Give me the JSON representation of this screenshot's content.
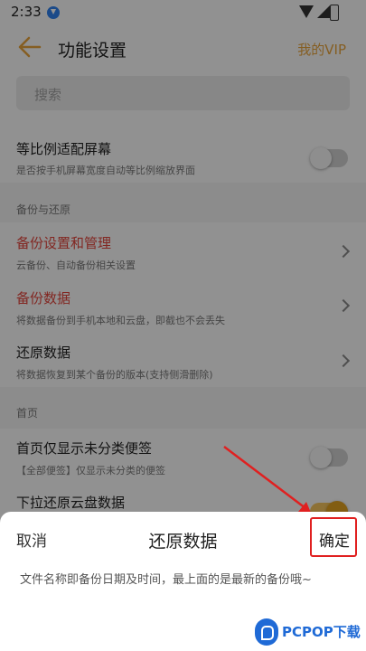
{
  "status_bar": {
    "time": "2:33"
  },
  "header": {
    "title": "功能设置",
    "vip_label": "我的VIP"
  },
  "search": {
    "placeholder": "搜索"
  },
  "settings": {
    "partial_top": "",
    "row_scale": {
      "title": "等比例适配屏幕",
      "subtitle": "是否按手机屏幕宽度自动等比例缩放界面",
      "toggle": "off"
    },
    "section_backup": "备份与还原",
    "row_backup_manage": {
      "title": "备份设置和管理",
      "subtitle": "云备份、自动备份相关设置"
    },
    "row_backup_data": {
      "title": "备份数据",
      "subtitle": "将数据备份到手机本地和云盘，即截也不会丢失"
    },
    "row_restore": {
      "title": "还原数据",
      "subtitle": "将数据恢复到某个备份的版本(支持侧滑删除)"
    },
    "section_home": "首页",
    "row_home_unclassified": {
      "title": "首页仅显示未分类便签",
      "subtitle": "【全部便签】仅显示未分类的便签",
      "toggle": "off"
    },
    "row_pull_restore": {
      "title": "下拉还原云盘数据",
      "toggle": "on"
    }
  },
  "sheet": {
    "cancel_label": "取消",
    "title": "还原数据",
    "confirm_label": "确定",
    "description": "文件名称即备份日期及时间，最上面的是最新的备份哦~"
  },
  "watermark": {
    "text": "PCPOP下载"
  },
  "colors": {
    "accent": "#e6a23c",
    "danger": "#e0443b",
    "annotation": "#e02020"
  }
}
